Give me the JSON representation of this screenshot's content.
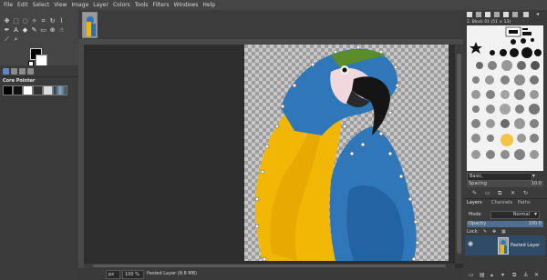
{
  "menu": [
    "File",
    "Edit",
    "Select",
    "View",
    "Image",
    "Layer",
    "Colors",
    "Tools",
    "Filters",
    "Windows",
    "Help"
  ],
  "left_dock": {
    "tool_options_title": "Core Pointer"
  },
  "brushes": {
    "title": "2. Block 01 (51 × 13)",
    "preset": "Basic,",
    "spacing_label": "Spacing",
    "spacing_value": "10.0"
  },
  "layers_panel": {
    "tabs": [
      "Layers",
      "Channels",
      "Paths"
    ],
    "mode_label": "Mode",
    "mode_value": "Normal",
    "opacity_label": "Opacity",
    "opacity_value": "100.0",
    "lock_label": "Lock:",
    "layer_name": "Pasted Layer"
  },
  "status": {
    "unit": "px",
    "zoom": "100 %",
    "info": "Pasted Layer (8.8 MB)"
  },
  "colors": {
    "ui_bg": "#454545",
    "parrot_yellow": "#f2b705",
    "parrot_blue": "#2f77b8",
    "parrot_green": "#5b8c2a"
  }
}
